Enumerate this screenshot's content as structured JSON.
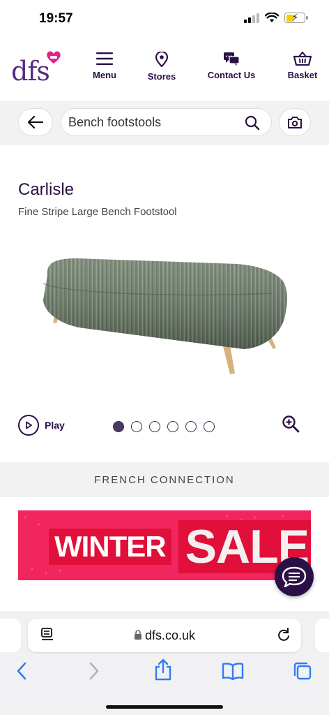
{
  "status": {
    "time": "19:57"
  },
  "header": {
    "logo": "dfs",
    "nav": [
      {
        "label": "Menu",
        "icon": "hamburger-icon"
      },
      {
        "label": "Stores",
        "icon": "location-pin-icon"
      },
      {
        "label": "Contact Us",
        "icon": "chat-bubbles-icon"
      },
      {
        "label": "Basket",
        "icon": "basket-icon"
      }
    ]
  },
  "search": {
    "value": "Bench footstools"
  },
  "product": {
    "title": "Carlisle",
    "subtitle": "Fine Stripe Large Bench Footstool",
    "play_label": "Play",
    "gallery_total": 6,
    "gallery_active": 1
  },
  "brand": {
    "label": "FRENCH CONNECTION"
  },
  "banner": {
    "line1": "WINTER",
    "line2": "SALE",
    "color": "#f2265e"
  },
  "browser": {
    "url": "dfs.co.uk"
  },
  "colors": {
    "brand_purple": "#2b1045",
    "logo_purple": "#5a2a82",
    "accent_pink": "#e0228a",
    "ios_blue": "#2f7cf6"
  }
}
